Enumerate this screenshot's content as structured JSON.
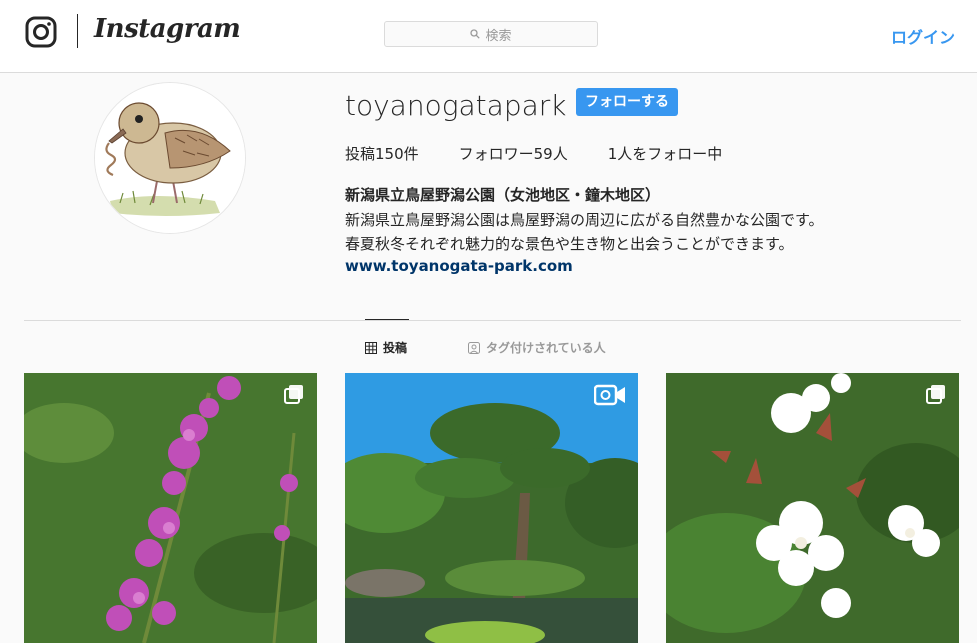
{
  "header": {
    "logo_glyph": "instagram-camera-icon",
    "wordmark": "Instagram",
    "search": {
      "placeholder": "検索",
      "icon": "search-icon"
    },
    "login_label": "ログイン",
    "accent_color": "#3897f0"
  },
  "profile": {
    "username": "toyanogatapark",
    "follow_label": "フォローする",
    "stats": {
      "posts": "投稿150件",
      "followers": "フォロワー59人",
      "following": "1人をフォロー中"
    },
    "full_name": "新潟県立鳥屋野潟公園（女池地区・鐘木地区）",
    "bio_lines": [
      "新潟県立鳥屋野潟公園は鳥屋野潟の周辺に広がる自然豊かな公園です。",
      "春夏秋冬それぞれ魅力的な景色や生き物と出会うことができます。"
    ],
    "website": "www.toyanogata-park.com",
    "avatar_description": "bird-illustration"
  },
  "tabs": [
    {
      "label": "投稿",
      "icon": "grid-icon",
      "active": true
    },
    {
      "label": "タグ付けされている人",
      "icon": "tag-person-icon",
      "active": false
    }
  ],
  "posts": [
    {
      "subject": "purple-loosestrife-flowers",
      "badge": "carousel-icon"
    },
    {
      "subject": "pine-tree-garden",
      "badge": "video-icon"
    },
    {
      "subject": "white-abelia-flowers",
      "badge": "carousel-icon"
    }
  ]
}
